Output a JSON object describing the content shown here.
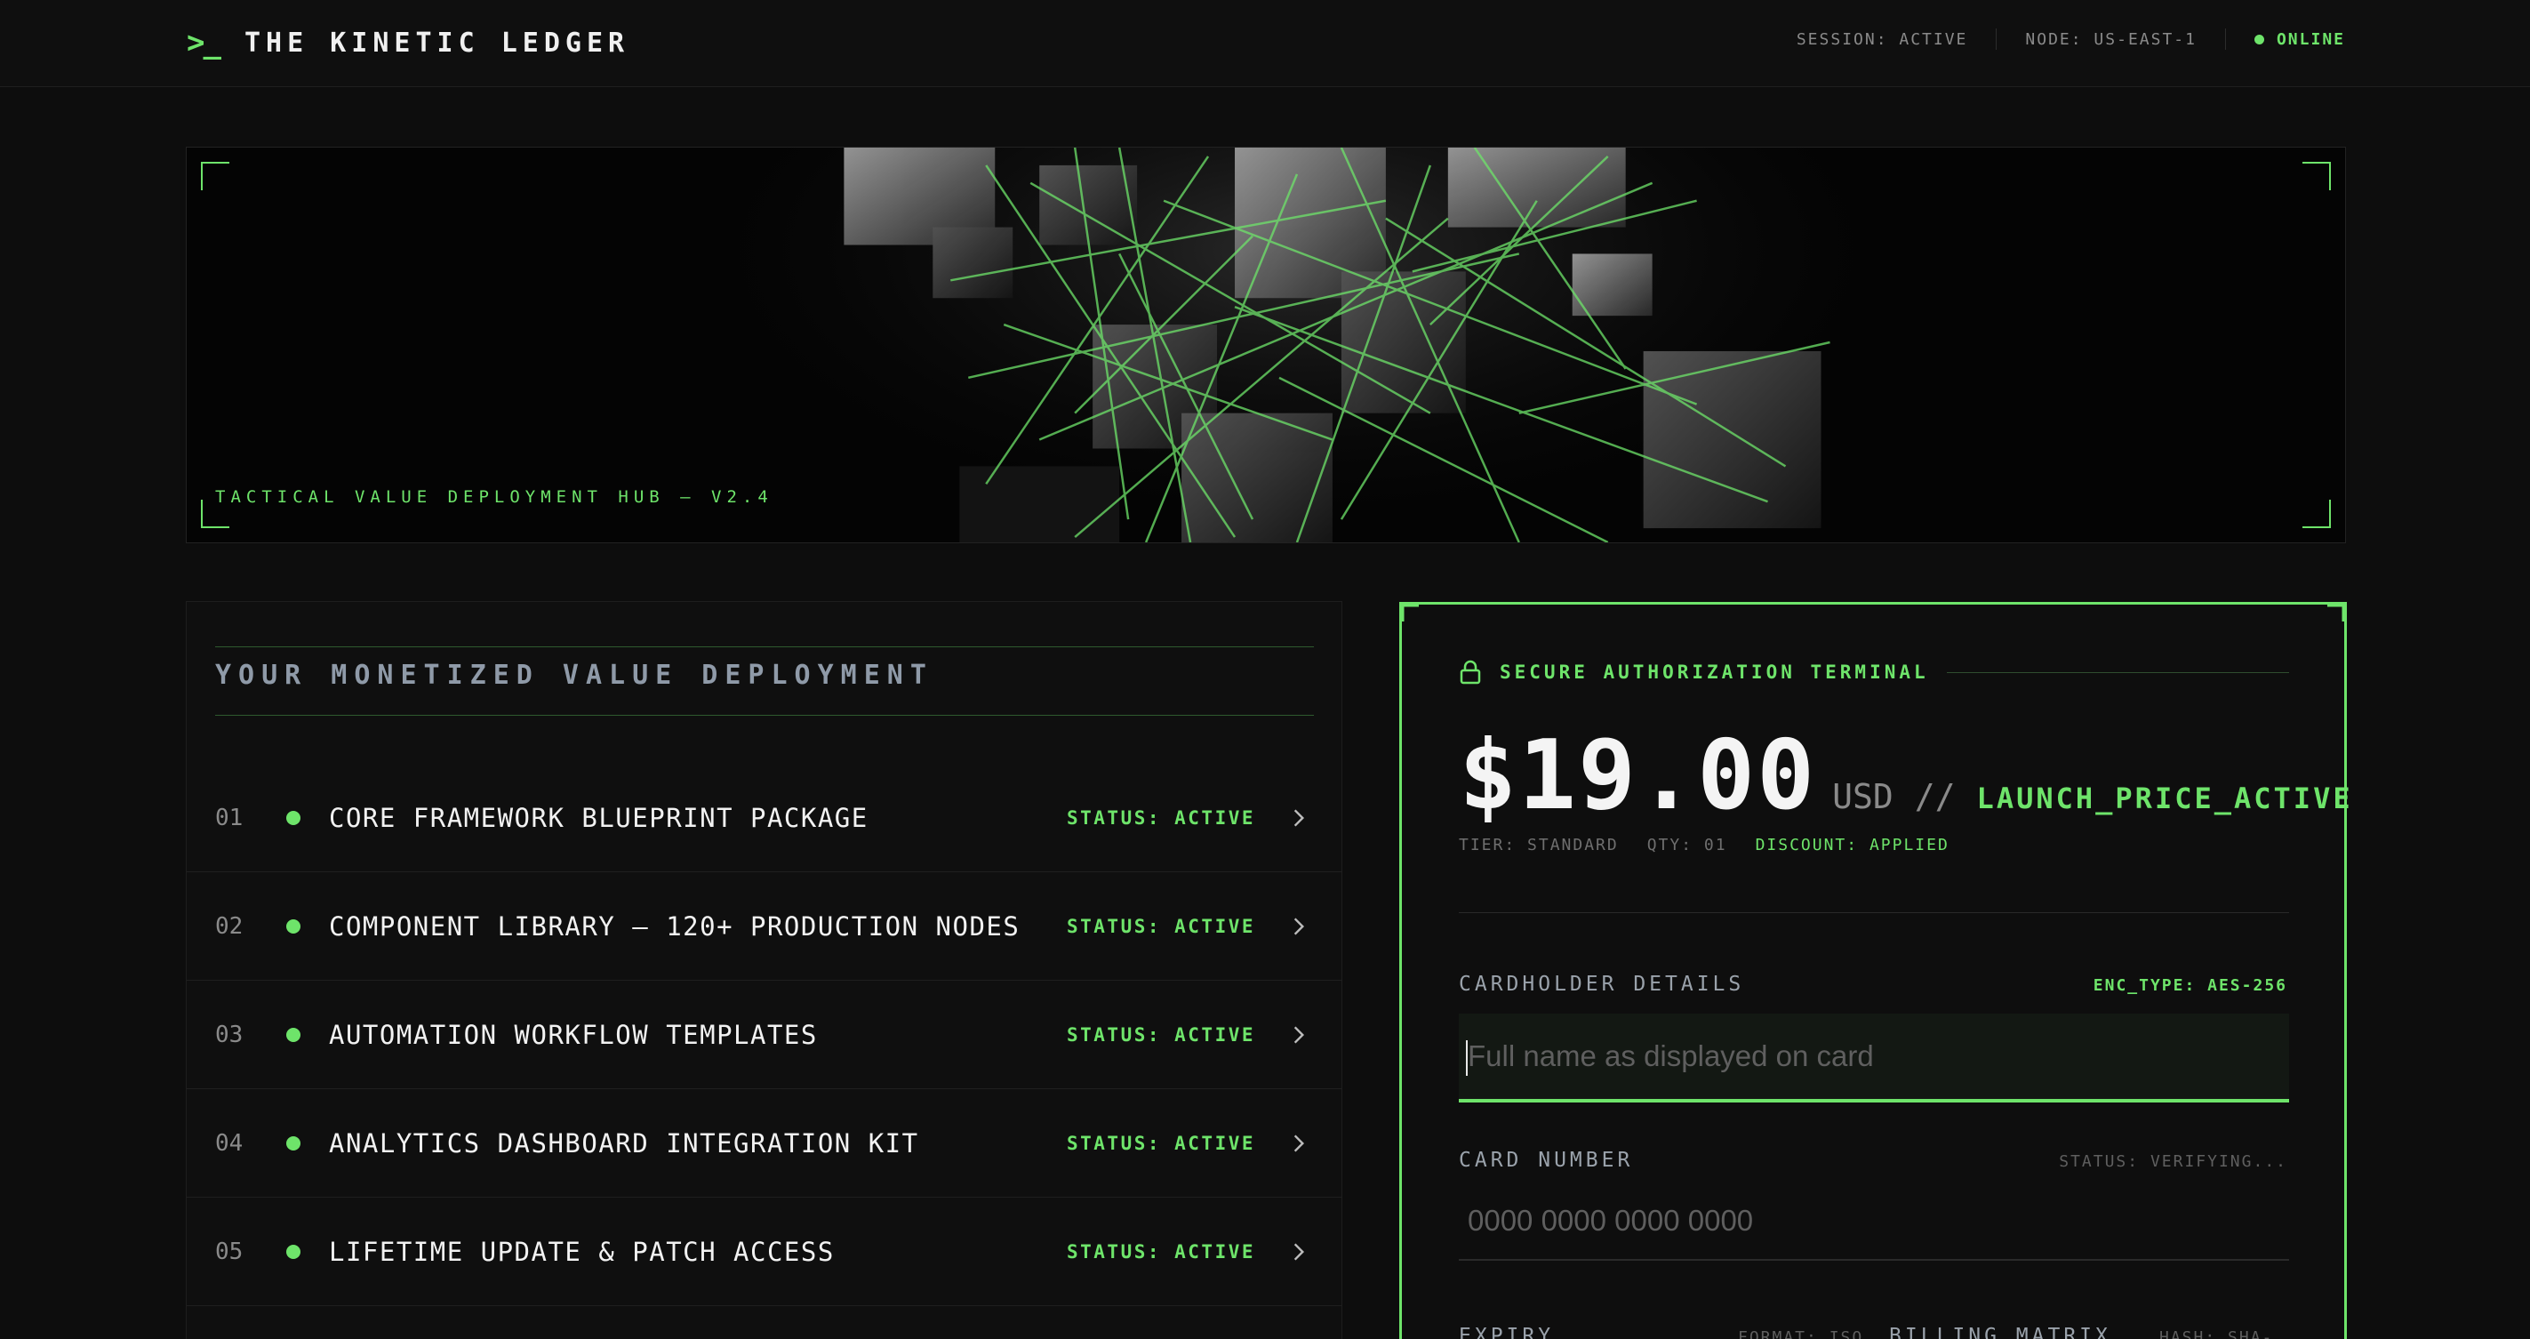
{
  "header": {
    "brand_icon": ">_",
    "title": "THE KINETIC LEDGER",
    "session": "SESSION: ACTIVE",
    "node": "NODE: US-EAST-1",
    "status": "ONLINE"
  },
  "hero": {
    "caption": "TACTICAL VALUE DEPLOYMENT HUB — V2.4",
    "image_icon": "network-cubes-illustration"
  },
  "deployment": {
    "title": "YOUR MONETIZED VALUE DEPLOYMENT",
    "items": [
      {
        "num": "01",
        "name": "CORE FRAMEWORK BLUEPRINT PACKAGE",
        "status": "STATUS: ACTIVE"
      },
      {
        "num": "02",
        "name": "COMPONENT LIBRARY — 120+ PRODUCTION NODES",
        "status": "STATUS: ACTIVE"
      },
      {
        "num": "03",
        "name": "AUTOMATION WORKFLOW TEMPLATES",
        "status": "STATUS: ACTIVE"
      },
      {
        "num": "04",
        "name": "ANALYTICS DASHBOARD INTEGRATION KIT",
        "status": "STATUS: ACTIVE"
      },
      {
        "num": "05",
        "name": "LIFETIME UPDATE & PATCH ACCESS",
        "status": "STATUS: ACTIVE"
      }
    ]
  },
  "terminal": {
    "title": "SECURE AUTHORIZATION TERMINAL",
    "price": "$19.00",
    "currency": "USD",
    "separator": "//",
    "price_state": "LAUNCH_PRICE_ACTIVE",
    "tier": "TIER: STANDARD",
    "qty": "QTY: 01",
    "discount": "DISCOUNT: APPLIED",
    "cardholder": {
      "label": "CARDHOLDER DETAILS",
      "tag": "ENC_TYPE: AES-256",
      "value": "",
      "placeholder": "Full name as displayed on card"
    },
    "card_number": {
      "label": "CARD NUMBER",
      "tag": "STATUS: VERIFYING...",
      "value": "",
      "placeholder": "0000 0000 0000 0000"
    },
    "expiry": {
      "label": "EXPIRY",
      "tag": "FORMAT: ISO"
    },
    "billing": {
      "label": "BILLING MATRIX",
      "tag": "HASH: SHA-"
    }
  },
  "colors": {
    "accent": "#6ee46a",
    "background": "#0d0d0d"
  }
}
